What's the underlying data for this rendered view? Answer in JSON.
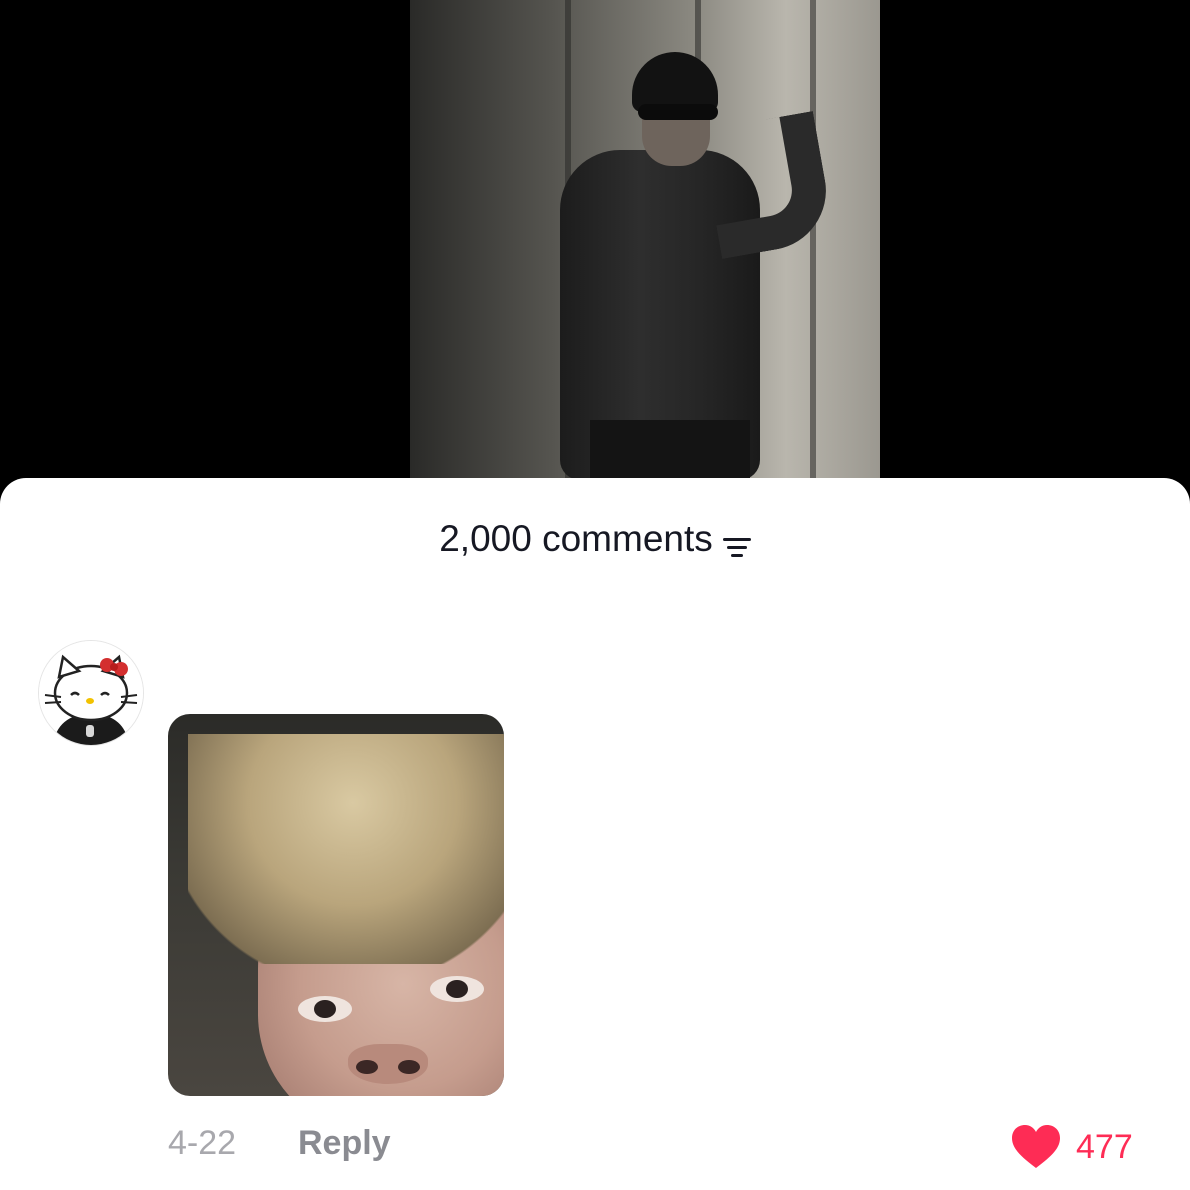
{
  "comments_header": {
    "count_label": "2,000 comments",
    "sort_icon": "filter-lines-icon"
  },
  "comment": {
    "avatar_icon": "hello-kitty-avatar",
    "date": "4-22",
    "reply_label": "Reply",
    "like_icon": "heart-icon",
    "like_count": "477"
  },
  "colors": {
    "like": "#fe2c55",
    "secondary_text": "#8a8b91",
    "date_text": "#a8a8ad",
    "primary_text": "#161823"
  }
}
